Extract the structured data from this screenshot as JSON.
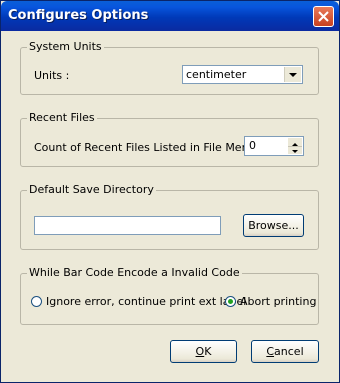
{
  "window": {
    "title": "Configures Options"
  },
  "system_units": {
    "legend": "System Units",
    "units_label": "Units :",
    "units_value": "centimeter"
  },
  "recent_files": {
    "legend": "Recent Files",
    "count_label": "Count of Recent Files Listed in File Menu",
    "count_value": "0"
  },
  "save_dir": {
    "legend": "Default Save Directory",
    "path_value": "",
    "browse_label": "Browse..."
  },
  "barcode": {
    "legend": "While Bar Code Encode a Invalid Code",
    "option_ignore": "Ignore error, continue print ext label",
    "option_abort": "Abort printing",
    "selected": "abort"
  },
  "buttons": {
    "ok_prefix": "O",
    "ok_rest": "K",
    "cancel_prefix": "C",
    "cancel_rest": "ancel"
  }
}
